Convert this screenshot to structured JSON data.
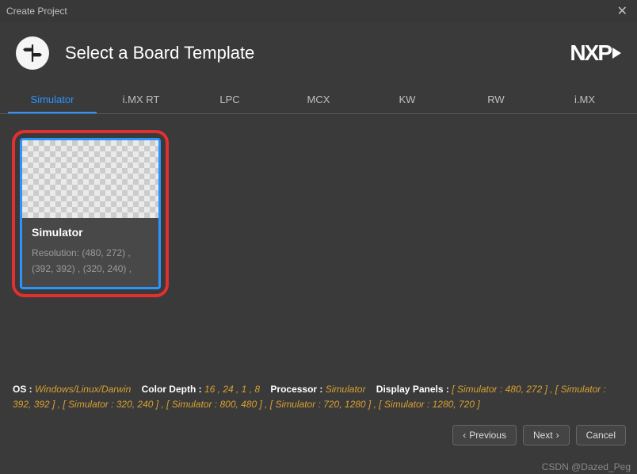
{
  "window": {
    "title": "Create Project"
  },
  "header": {
    "title": "Select a Board Template",
    "logo": "NXP"
  },
  "tabs": [
    {
      "label": "Simulator",
      "active": true
    },
    {
      "label": "i.MX RT"
    },
    {
      "label": "LPC"
    },
    {
      "label": "MCX"
    },
    {
      "label": "KW"
    },
    {
      "label": "RW"
    },
    {
      "label": "i.MX"
    }
  ],
  "card": {
    "title": "Simulator",
    "subtitle": "Resolution: (480, 272) , (392, 392) , (320, 240) ,"
  },
  "info": {
    "os_label": "OS :",
    "os_val": "Windows/Linux/Darwin",
    "cd_label": "Color Depth :",
    "cd_val": "16 , 24 , 1 , 8",
    "proc_label": "Processor :",
    "proc_val": "Simulator",
    "dp_label": "Display Panels :",
    "dp_val": "[ Simulator : 480, 272 ] , [ Simulator : 392, 392 ] , [ Simulator : 320, 240 ] , [ Simulator : 800, 480 ] , [ Simulator : 720, 1280 ] , [ Simulator : 1280, 720 ]"
  },
  "footer": {
    "previous": "Previous",
    "next": "Next",
    "cancel": "Cancel"
  },
  "watermark": "CSDN @Dazed_Peg"
}
